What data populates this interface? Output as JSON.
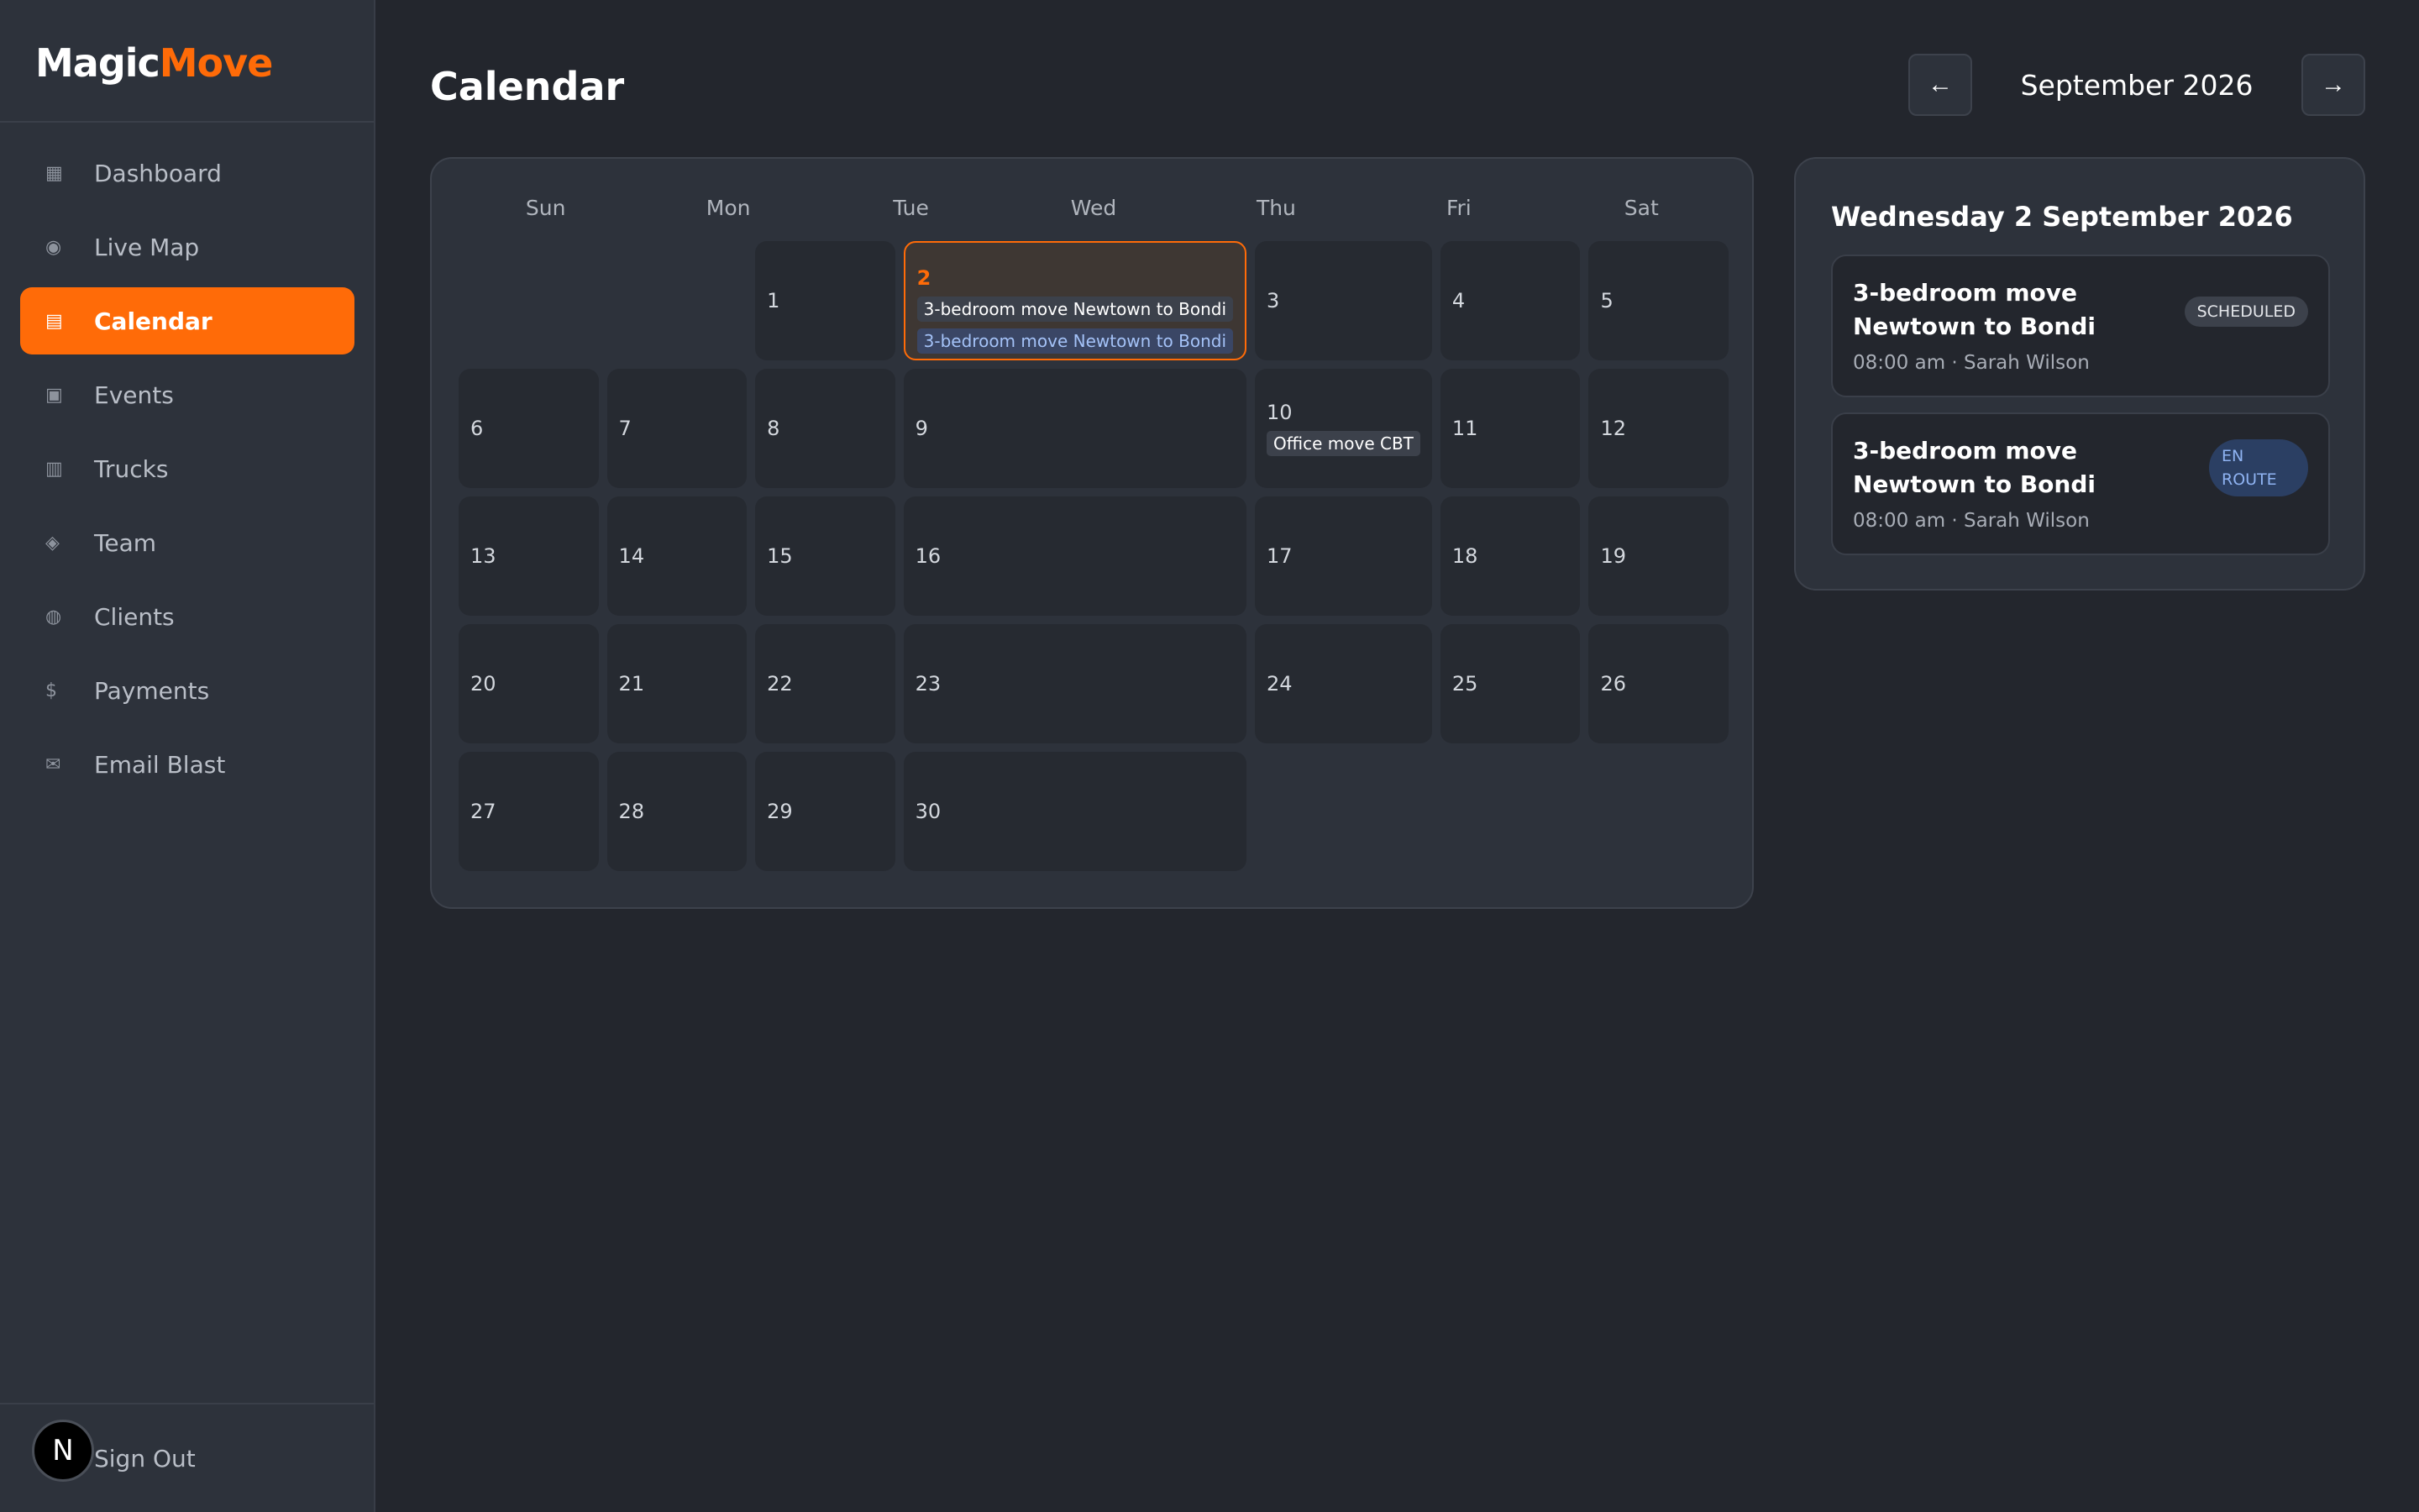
{
  "brand": {
    "part1": "Magic",
    "part2": "Move",
    "accent": "#ff6b08"
  },
  "sidebar": {
    "items": [
      {
        "label": "Dashboard",
        "icon": "▦",
        "icon_name": "dashboard-icon",
        "active": false
      },
      {
        "label": "Live Map",
        "icon": "◉",
        "icon_name": "map-icon",
        "active": false
      },
      {
        "label": "Calendar",
        "icon": "▤",
        "icon_name": "calendar-icon",
        "active": true
      },
      {
        "label": "Events",
        "icon": "▣",
        "icon_name": "events-icon",
        "active": false
      },
      {
        "label": "Trucks",
        "icon": "▥",
        "icon_name": "truck-icon",
        "active": false
      },
      {
        "label": "Team",
        "icon": "◈",
        "icon_name": "team-icon",
        "active": false
      },
      {
        "label": "Clients",
        "icon": "◍",
        "icon_name": "clients-icon",
        "active": false
      },
      {
        "label": "Payments",
        "icon": "$",
        "icon_name": "payments-icon",
        "active": false
      },
      {
        "label": "Email Blast",
        "icon": "✉",
        "icon_name": "email-icon",
        "active": false
      }
    ],
    "avatar_initial": "N",
    "signout_label": "Sign Out"
  },
  "header": {
    "title": "Calendar",
    "prev_label": "←",
    "next_label": "→",
    "month_label": "September 2026"
  },
  "calendar": {
    "weekdays": [
      "Sun",
      "Mon",
      "Tue",
      "Wed",
      "Thu",
      "Fri",
      "Sat"
    ],
    "days": [
      {
        "day": null
      },
      {
        "day": null
      },
      {
        "day": "1"
      },
      {
        "day": "2",
        "selected": true,
        "events": [
          {
            "label": "3-bedroom move Newtown to Bondi",
            "status": "scheduled"
          },
          {
            "label": "3-bedroom move Newtown to Bondi",
            "status": "enroute"
          }
        ]
      },
      {
        "day": "3"
      },
      {
        "day": "4"
      },
      {
        "day": "5"
      },
      {
        "day": "6"
      },
      {
        "day": "7"
      },
      {
        "day": "8"
      },
      {
        "day": "9"
      },
      {
        "day": "10",
        "events": [
          {
            "label": "Office move CBT",
            "status": "scheduled"
          }
        ]
      },
      {
        "day": "11"
      },
      {
        "day": "12"
      },
      {
        "day": "13"
      },
      {
        "day": "14"
      },
      {
        "day": "15"
      },
      {
        "day": "16"
      },
      {
        "day": "17"
      },
      {
        "day": "18"
      },
      {
        "day": "19"
      },
      {
        "day": "20"
      },
      {
        "day": "21"
      },
      {
        "day": "22"
      },
      {
        "day": "23"
      },
      {
        "day": "24"
      },
      {
        "day": "25"
      },
      {
        "day": "26"
      },
      {
        "day": "27"
      },
      {
        "day": "28"
      },
      {
        "day": "29"
      },
      {
        "day": "30"
      }
    ]
  },
  "detail": {
    "title": "Wednesday 2 September 2026",
    "events": [
      {
        "title": "3-bedroom move Newtown to Bondi",
        "meta": "08:00 am · Sarah Wilson",
        "badge": "SCHEDULED",
        "badge_type": "scheduled"
      },
      {
        "title": "3-bedroom move Newtown to Bondi",
        "meta": "08:00 am · Sarah Wilson",
        "badge": "EN ROUTE",
        "badge_type": "enroute"
      }
    ]
  }
}
